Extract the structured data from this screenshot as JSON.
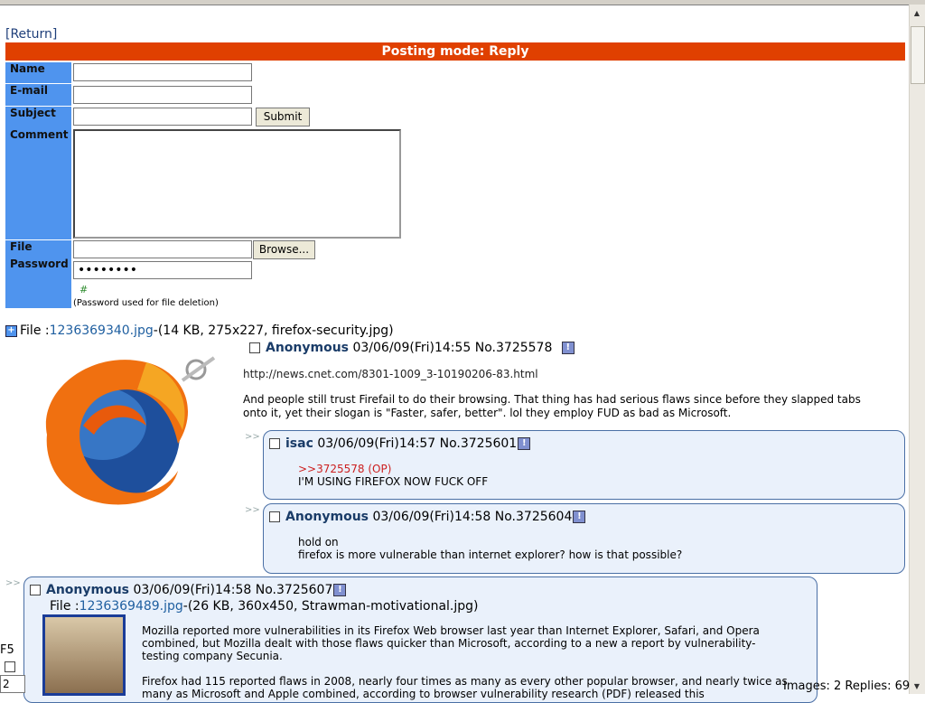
{
  "nav": {
    "return_label": "[Return]"
  },
  "form": {
    "mode_label": "Posting mode: Reply",
    "labels": {
      "name": "Name",
      "email": "E-mail",
      "subject": "Subject",
      "comment": "Comment",
      "file": "File",
      "password": "Password"
    },
    "values": {
      "name": "",
      "email": "",
      "subject": "",
      "comment": "",
      "password": "••••••••"
    },
    "submit_label": "Submit",
    "browse_label": "Browse...",
    "hash_symbol": "#",
    "password_note": "(Password used for file deletion)"
  },
  "thread": {
    "op": {
      "file_prefix": "File :",
      "file_name": "1236369340.jpg",
      "file_meta": "-(14 KB, 275x227, firefox-security.jpg)",
      "poster": "Anonymous",
      "datetime": "03/06/09(Fri)14:55",
      "number": "No.3725578",
      "link_text": "http://news.cnet.com/8301-1009_3-10190206-83.html",
      "comment": "And people still trust Firefail to do their browsing. That thing has had serious flaws since before they slapped tabs onto it, yet their slogan is \"Faster, safer, better\". lol they employ FUD as bad as Microsoft."
    },
    "replies": [
      {
        "arrow": ">>",
        "poster": "isac",
        "datetime": "03/06/09(Fri)14:57",
        "number": "No.3725601",
        "quote": ">>3725578 (OP)",
        "line1": "I'M USING FIREFOX NOW FUCK OFF"
      },
      {
        "arrow": ">>",
        "poster": "Anonymous",
        "datetime": "03/06/09(Fri)14:58",
        "number": "No.3725604",
        "line1": "hold on",
        "line2": "firefox is more vulnerable than internet explorer? how is that possible?"
      },
      {
        "arrow": ">>",
        "poster": "Anonymous",
        "datetime": "03/06/09(Fri)14:58",
        "number": "No.3725607",
        "file_prefix": "File :",
        "file_name": "1236369489.jpg",
        "file_meta": "-(26 KB, 360x450, Strawman-motivational.jpg)",
        "para1": "Mozilla reported more vulnerabilities in its Firefox Web browser last year than Internet Explorer, Safari, and Opera combined, but Mozilla dealt with those flaws quicker than Microsoft, according to a new a report by vulnerability-testing company Secunia.",
        "para2": "Firefox had 115 reported flaws in 2008, nearly four times as many as every other popular browser, and nearly twice as many as Microsoft and Apple combined, according to browser vulnerability research (PDF) released this"
      }
    ]
  },
  "footer": {
    "f5_label": "F5",
    "f5_value": "2",
    "status": "Images: 2 Replies: 69"
  },
  "colors": {
    "accent_bar": "#e04000",
    "label_bg": "#4f94ee",
    "reply_bg": "#eaf1fb",
    "poster_name": "#1a3c68",
    "quote": "#cc2020"
  }
}
